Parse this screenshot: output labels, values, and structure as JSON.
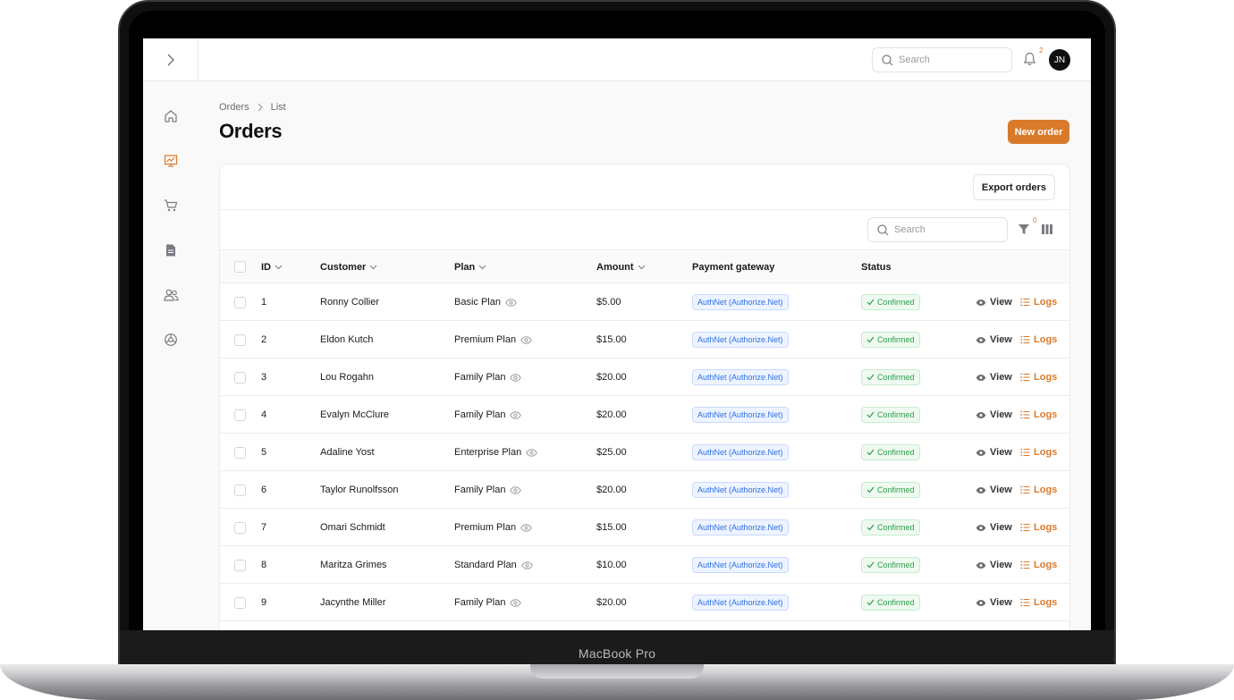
{
  "device": {
    "label": "MacBook Pro"
  },
  "topbar": {
    "search_placeholder": "Search",
    "notification_count": "2",
    "avatar_initials": "JN"
  },
  "sidebar": {
    "items": [
      {
        "name": "home-icon",
        "active": false
      },
      {
        "name": "chart-icon",
        "active": true
      },
      {
        "name": "cart-icon",
        "active": false
      },
      {
        "name": "document-icon",
        "active": false
      },
      {
        "name": "users-icon",
        "active": false
      },
      {
        "name": "settings-icon",
        "active": false
      }
    ]
  },
  "breadcrumb": {
    "root": "Orders",
    "current": "List"
  },
  "page": {
    "title": "Orders",
    "new_order_label": "New order"
  },
  "card": {
    "export_label": "Export orders",
    "search_placeholder": "Search",
    "filter_count": "0"
  },
  "table": {
    "headers": {
      "id": "ID",
      "customer": "Customer",
      "plan": "Plan",
      "amount": "Amount",
      "gateway": "Payment gateway",
      "status": "Status"
    },
    "view_label": "View",
    "logs_label": "Logs",
    "rows": [
      {
        "id": "1",
        "customer": "Ronny Collier",
        "plan": "Basic Plan",
        "amount": "$5.00",
        "gateway": "AuthNet (Authorize.Net)",
        "status": "Confirmed"
      },
      {
        "id": "2",
        "customer": "Eldon Kutch",
        "plan": "Premium Plan",
        "amount": "$15.00",
        "gateway": "AuthNet (Authorize.Net)",
        "status": "Confirmed"
      },
      {
        "id": "3",
        "customer": "Lou Rogahn",
        "plan": "Family Plan",
        "amount": "$20.00",
        "gateway": "AuthNet (Authorize.Net)",
        "status": "Confirmed"
      },
      {
        "id": "4",
        "customer": "Evalyn McClure",
        "plan": "Family Plan",
        "amount": "$20.00",
        "gateway": "AuthNet (Authorize.Net)",
        "status": "Confirmed"
      },
      {
        "id": "5",
        "customer": "Adaline Yost",
        "plan": "Enterprise Plan",
        "amount": "$25.00",
        "gateway": "AuthNet (Authorize.Net)",
        "status": "Confirmed"
      },
      {
        "id": "6",
        "customer": "Taylor Runolfsson",
        "plan": "Family Plan",
        "amount": "$20.00",
        "gateway": "AuthNet (Authorize.Net)",
        "status": "Confirmed"
      },
      {
        "id": "7",
        "customer": "Omari Schmidt",
        "plan": "Premium Plan",
        "amount": "$15.00",
        "gateway": "AuthNet (Authorize.Net)",
        "status": "Confirmed"
      },
      {
        "id": "8",
        "customer": "Maritza Grimes",
        "plan": "Standard Plan",
        "amount": "$10.00",
        "gateway": "AuthNet (Authorize.Net)",
        "status": "Confirmed"
      },
      {
        "id": "9",
        "customer": "Jacynthe Miller",
        "plan": "Family Plan",
        "amount": "$20.00",
        "gateway": "AuthNet (Authorize.Net)",
        "status": "Confirmed"
      }
    ]
  },
  "colors": {
    "accent": "#d97a2b",
    "gateway_text": "#2f6fe0",
    "status_text": "#2e9a4c"
  }
}
